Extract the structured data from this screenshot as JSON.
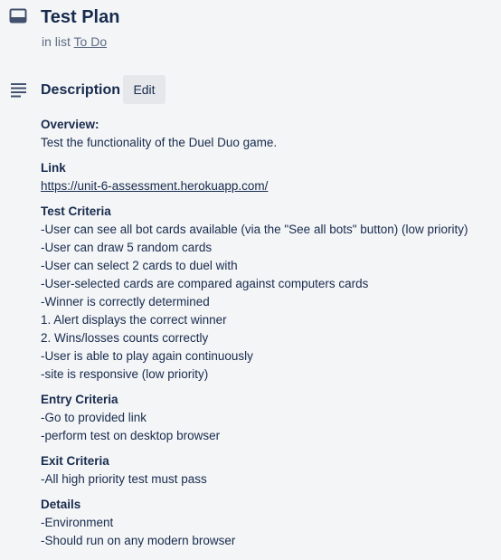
{
  "card": {
    "icon": "card-icon",
    "title": "Test Plan",
    "in_list_prefix": "in list",
    "list_name": "To Do"
  },
  "description": {
    "icon": "description-lines-icon",
    "title": "Description",
    "edit_label": "Edit",
    "sections": [
      {
        "heading": "Overview:",
        "lines": [
          "Test the functionality of the Duel Duo game."
        ]
      },
      {
        "heading": "Link",
        "link": "https://unit-6-assessment.herokuapp.com/"
      },
      {
        "heading": "Test Criteria",
        "lines": [
          "-User can see all bot cards available (via the \"See all bots\" button) (low priority)",
          "-User can draw 5 random cards",
          "-User can select 2 cards to duel with",
          "-User-selected cards are compared against computers cards",
          "-Winner is correctly determined",
          "1. Alert displays the correct winner",
          "2. Wins/losses counts correctly",
          "-User is able to play again continuously",
          "-site is responsive (low priority)"
        ]
      },
      {
        "heading": "Entry Criteria",
        "lines": [
          "-Go to provided link",
          "-perform test on desktop browser"
        ]
      },
      {
        "heading": "Exit Criteria",
        "lines": [
          "-All high priority test must pass"
        ]
      },
      {
        "heading": "Details",
        "lines": [
          "-Environment",
          "-Should run on any modern browser"
        ]
      }
    ]
  }
}
